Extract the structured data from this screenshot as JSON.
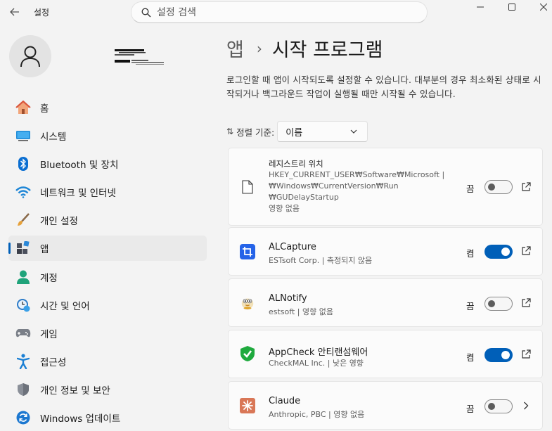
{
  "window": {
    "app_title": "설정",
    "back_icon": "back-arrow-icon",
    "search_placeholder": "설정 검색",
    "controls": [
      "minimize-icon",
      "maximize-icon",
      "close-icon"
    ]
  },
  "profile": {
    "avatar_icon": "person-icon"
  },
  "sidebar": {
    "items": [
      {
        "label": "홈",
        "icon": "home-icon",
        "active": false
      },
      {
        "label": "시스템",
        "icon": "system-icon",
        "active": false
      },
      {
        "label": "Bluetooth 및 장치",
        "icon": "bluetooth-icon",
        "active": false
      },
      {
        "label": "네트워크 및 인터넷",
        "icon": "wifi-icon",
        "active": false
      },
      {
        "label": "개인 설정",
        "icon": "brush-icon",
        "active": false
      },
      {
        "label": "앱",
        "icon": "apps-icon",
        "active": true
      },
      {
        "label": "계정",
        "icon": "account-icon",
        "active": false
      },
      {
        "label": "시간 및 언어",
        "icon": "clock-globe-icon",
        "active": false
      },
      {
        "label": "게임",
        "icon": "gamepad-icon",
        "active": false
      },
      {
        "label": "접근성",
        "icon": "accessibility-icon",
        "active": false
      },
      {
        "label": "개인 정보 및 보안",
        "icon": "shield-icon",
        "active": false
      },
      {
        "label": "Windows 업데이트",
        "icon": "update-icon",
        "active": false
      }
    ]
  },
  "main": {
    "breadcrumb_parent": "앱",
    "breadcrumb_sep": "›",
    "title": "시작 프로그램",
    "description": "로그인할 때 앱이 시작되도록 설정할 수 있습니다. 대부분의 경우 최소화된 상태로 시작되거나 백그라운드 작업이 실행될 때만 시작될 수 있습니다.",
    "sort_label": "정렬 기준:",
    "sort_value": "이름",
    "registry_card": {
      "title": "레지스트리 위치",
      "path_line1": "HKEY_CURRENT_USER₩Software₩Microsoft  |",
      "path_line2": "₩Windows₩CurrentVersion₩Run",
      "path_line3": "₩GUDelayStartup",
      "impact": "영향 없음",
      "state": "끔",
      "enabled": false,
      "icon": "file-icon",
      "trailing_icon": "open-external-icon"
    },
    "apps": [
      {
        "name": "ALCapture",
        "publisher": "ESTsoft Corp.",
        "impact": "측정되지 않음",
        "state": "켬",
        "enabled": true,
        "icon": "alcapture-icon",
        "trailing_icon": "open-external-icon"
      },
      {
        "name": "ALNotify",
        "publisher": "estsoft",
        "impact": "영향 없음",
        "state": "끔",
        "enabled": false,
        "icon": "alnotify-icon",
        "trailing_icon": "open-external-icon"
      },
      {
        "name": "AppCheck 안티랜섬웨어",
        "publisher": "CheckMAL Inc.",
        "impact": "낮은 영향",
        "state": "켬",
        "enabled": true,
        "icon": "appcheck-icon",
        "trailing_icon": "open-external-icon"
      },
      {
        "name": "Claude",
        "publisher": "Anthropic, PBC",
        "impact": "영향 없음",
        "state": "끔",
        "enabled": false,
        "icon": "claude-icon",
        "trailing_icon": "chevron-right-icon"
      }
    ]
  },
  "colors": {
    "accent": "#005fb8",
    "background": "#f3f3f3",
    "card": "#fbfbfb"
  }
}
